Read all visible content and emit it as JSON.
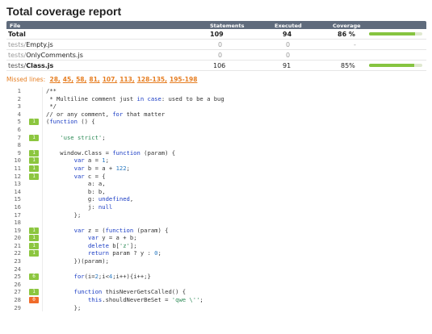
{
  "title": "Total coverage report",
  "table": {
    "headers": {
      "file": "File",
      "statements": "Statements",
      "executed": "Executed",
      "coverage": "Coverage"
    },
    "rows": [
      {
        "file_dir": "",
        "file_name": "Total",
        "statements": "109",
        "executed": "94",
        "coverage": "86 %",
        "coverage_fraction": 0.86,
        "kind": "total"
      },
      {
        "file_dir": "tests/",
        "file_name": "Empty.js",
        "statements": "0",
        "executed": "0",
        "coverage": "-",
        "coverage_fraction": null,
        "kind": "empty"
      },
      {
        "file_dir": "tests/",
        "file_name": "OnlyComments.js",
        "statements": "0",
        "executed": "0",
        "coverage": "",
        "coverage_fraction": null,
        "kind": "empty"
      },
      {
        "file_dir": "tests/",
        "file_name": "Class.js",
        "statements": "106",
        "executed": "91",
        "coverage": "85%",
        "coverage_fraction": 0.85,
        "kind": "file"
      }
    ]
  },
  "missed_lines": {
    "label": "Missed lines:",
    "links": [
      "28,",
      "45,",
      "58,",
      "81,",
      "107,",
      "113,",
      "128-135,",
      "195-198"
    ]
  },
  "colors": {
    "covered": "#8cc63f",
    "missed": "#f06b2a",
    "header_bg": "#5f6b7c",
    "keyword": "#1a3cc4"
  },
  "code_lines": [
    {
      "n": "1",
      "hits": "",
      "state": "none",
      "code": "/**"
    },
    {
      "n": "2",
      "hits": "",
      "state": "none",
      "code": " * Multiline comment just in case: used to be a bug"
    },
    {
      "n": "3",
      "hits": "",
      "state": "none",
      "code": " */"
    },
    {
      "n": "4",
      "hits": "",
      "state": "none",
      "code": "// or any comment, for that matter"
    },
    {
      "n": "5",
      "hits": "1",
      "state": "covered",
      "code": "(function () {"
    },
    {
      "n": "6",
      "hits": "",
      "state": "none",
      "code": ""
    },
    {
      "n": "7",
      "hits": "1",
      "state": "covered",
      "code": "    'use strict';"
    },
    {
      "n": "8",
      "hits": "",
      "state": "none",
      "code": ""
    },
    {
      "n": "9",
      "hits": "1",
      "state": "covered",
      "code": "    window.Class = function (param) {"
    },
    {
      "n": "10",
      "hits": "1",
      "state": "covered",
      "code": "        var a = 1;"
    },
    {
      "n": "11",
      "hits": "1",
      "state": "covered",
      "code": "        var b = a + 122;"
    },
    {
      "n": "12",
      "hits": "1",
      "state": "covered",
      "code": "        var c = {"
    },
    {
      "n": "13",
      "hits": "",
      "state": "none",
      "code": "            a: a,"
    },
    {
      "n": "14",
      "hits": "",
      "state": "none",
      "code": "            b: b,"
    },
    {
      "n": "15",
      "hits": "",
      "state": "none",
      "code": "            g: undefined,"
    },
    {
      "n": "16",
      "hits": "",
      "state": "none",
      "code": "            j: null"
    },
    {
      "n": "17",
      "hits": "",
      "state": "none",
      "code": "        };"
    },
    {
      "n": "18",
      "hits": "",
      "state": "none",
      "code": ""
    },
    {
      "n": "19",
      "hits": "1",
      "state": "covered",
      "code": "        var z = (function (param) {"
    },
    {
      "n": "20",
      "hits": "1",
      "state": "covered",
      "code": "            var y = a + b;"
    },
    {
      "n": "21",
      "hits": "1",
      "state": "covered",
      "code": "            delete b['z'];"
    },
    {
      "n": "22",
      "hits": "1",
      "state": "covered",
      "code": "            return param ? y : 0;"
    },
    {
      "n": "23",
      "hits": "",
      "state": "none",
      "code": "        })(param);"
    },
    {
      "n": "24",
      "hits": "",
      "state": "none",
      "code": ""
    },
    {
      "n": "25",
      "hits": "6",
      "state": "covered",
      "code": "        for(i=2;i<4;i++){i++;}"
    },
    {
      "n": "26",
      "hits": "",
      "state": "none",
      "code": ""
    },
    {
      "n": "27",
      "hits": "1",
      "state": "covered",
      "code": "        function thisNeverGetsCalled() {"
    },
    {
      "n": "28",
      "hits": "0",
      "state": "missed",
      "code": "            this.shouldNeverBeSet = 'qwe \\'';"
    },
    {
      "n": "29",
      "hits": "",
      "state": "none",
      "code": "        };"
    }
  ]
}
